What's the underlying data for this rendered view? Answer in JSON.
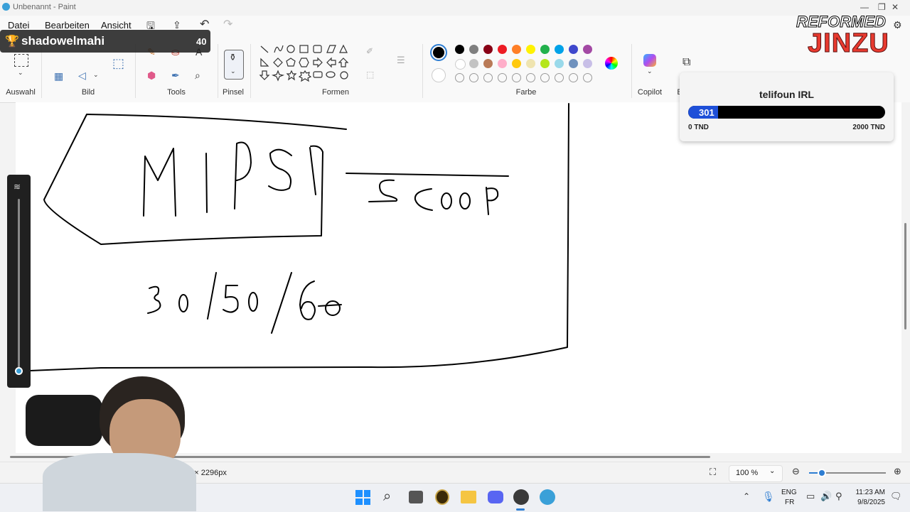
{
  "window": {
    "title": "Unbenannt - Paint"
  },
  "menu": {
    "file": "Datei",
    "edit": "Bearbeiten",
    "view": "Ansicht"
  },
  "ribbon": {
    "groups": {
      "select": "Auswahl",
      "image": "Bild",
      "tools": "Tools",
      "brushes": "Pinsel",
      "shapes": "Formen",
      "colors": "Farbe",
      "copilot": "Copilot",
      "layers": "E"
    }
  },
  "palette": {
    "row1": [
      "#000000",
      "#7f7f7f",
      "#880015",
      "#ed1c24",
      "#ff7f27",
      "#fff200",
      "#22b14c",
      "#00a2e8",
      "#3f48cc",
      "#a349a4"
    ],
    "row2": [
      "#ffffff",
      "#c3c3c3",
      "#b97a57",
      "#ffaec9",
      "#ffc90e",
      "#efe4b0",
      "#b5e61d",
      "#99d9ea",
      "#7092be",
      "#c8bfe7"
    ],
    "primary": "#000000",
    "secondary": "#ffffff"
  },
  "drawing": {
    "word1": "MiPSl",
    "word2": "Scoop",
    "numbers": "30/50/60"
  },
  "overlay": {
    "user": "shadowelmahi",
    "count": "40",
    "logo_top": "REFORMED",
    "logo_bottom": "JINZU",
    "goal_title": "telifoun IRL",
    "goal_value": "301",
    "goal_progress": 0.1505,
    "goal_min": "0 TND",
    "goal_max": "2000 TND"
  },
  "status": {
    "canvas_size": "54 × 2296px",
    "zoom": "100 %"
  },
  "taskbar": {
    "lang_top": "ENG",
    "lang_bottom": "FR",
    "time": "11:23 AM",
    "date": "9/8/2025"
  }
}
